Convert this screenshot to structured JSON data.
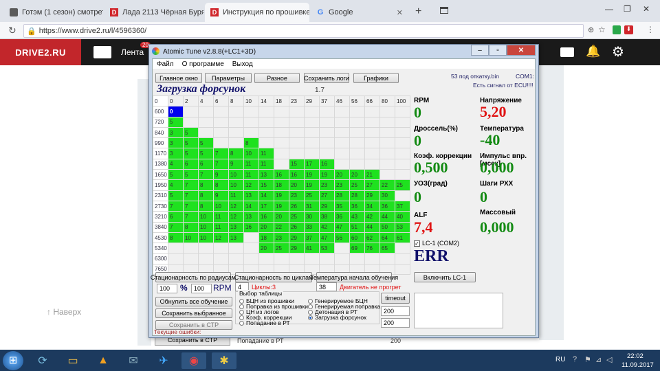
{
  "browser": {
    "tabs": [
      {
        "label": "Готэм (1 сезон) смотреть онлай",
        "fav_color": "#5a5a5a"
      },
      {
        "label": "Лада 2113 Чёрная Буря",
        "fav_color": "#d0262b",
        "fav_letter": "D"
      },
      {
        "label": "Инструкция по прошивке ВАЗ",
        "fav_color": "#d0262b",
        "fav_letter": "D"
      },
      {
        "label": "Google",
        "fav_letter": "G"
      }
    ],
    "url": "https://www.drive2.ru/l/4596360/",
    "win_min": "—",
    "win_max": "❐",
    "win_close": "✕"
  },
  "site": {
    "logo": "DRIVE2.RU",
    "nav_lenta": "Лента",
    "badge": "20",
    "back_link": "↑ Наверх",
    "bg_rows": [
      "Сохранить в СТР",
      "Попадание в РТ",
      "200"
    ]
  },
  "app": {
    "title": "Atomic Tune   v2.8.8(+LC1+3D)",
    "menu": [
      "Файл",
      "О программе",
      "Выход"
    ],
    "toolbar": [
      "Главное окно",
      "Параметры",
      "Разное",
      "Сохранить логи",
      "Графики"
    ],
    "info_file": "53 под откатку.bin",
    "info_com": "COM1:",
    "info_ecu": "Есть сигнал от ECU!!!!",
    "section_title": "Загрузка форсунок",
    "section_value": "1.7",
    "col_headers": [
      "0",
      "0",
      "2",
      "4",
      "6",
      "8",
      "10",
      "14",
      "18",
      "23",
      "29",
      "37",
      "46",
      "56",
      "66",
      "80",
      "100"
    ],
    "rows": [
      {
        "rpm": "600",
        "cells": [
          [
            "0",
            "b"
          ]
        ]
      },
      {
        "rpm": "720",
        "cells": [
          [
            "5",
            "g"
          ]
        ]
      },
      {
        "rpm": "840",
        "cells": [
          [
            "3",
            "g"
          ],
          [
            "5",
            "g"
          ]
        ]
      },
      {
        "rpm": "990",
        "cells": [
          [
            "3",
            "g"
          ],
          [
            "5",
            "g"
          ],
          [
            "5",
            "g"
          ],
          [
            "",
            ""
          ],
          [
            "",
            ""
          ],
          [
            "8",
            "g"
          ]
        ]
      },
      {
        "rpm": "1170",
        "cells": [
          [
            "3",
            "g"
          ],
          [
            "5",
            "g"
          ],
          [
            "5",
            "g"
          ],
          [
            "7",
            "g"
          ],
          [
            "8",
            "g"
          ],
          [
            "10",
            "g"
          ],
          [
            "11",
            "g"
          ]
        ]
      },
      {
        "rpm": "1380",
        "cells": [
          [
            "4",
            "g"
          ],
          [
            "6",
            "g"
          ],
          [
            "6",
            "g"
          ],
          [
            "7",
            "g"
          ],
          [
            "9",
            "g"
          ],
          [
            "11",
            "g"
          ],
          [
            "11",
            "g"
          ],
          [
            "",
            ""
          ],
          [
            "15",
            "g"
          ],
          [
            "17",
            "g"
          ],
          [
            "16",
            "g"
          ]
        ]
      },
      {
        "rpm": "1650",
        "cells": [
          [
            "5",
            "g"
          ],
          [
            "5",
            "g"
          ],
          [
            "7",
            "g"
          ],
          [
            "9",
            "g"
          ],
          [
            "10",
            "g"
          ],
          [
            "11",
            "g"
          ],
          [
            "13",
            "g"
          ],
          [
            "16",
            "g"
          ],
          [
            "16",
            "g"
          ],
          [
            "19",
            "g"
          ],
          [
            "19",
            "g"
          ],
          [
            "20",
            "g"
          ],
          [
            "20",
            "g"
          ],
          [
            "21",
            "g"
          ]
        ]
      },
      {
        "rpm": "1950",
        "cells": [
          [
            "4",
            "g"
          ],
          [
            "7",
            "g"
          ],
          [
            "8",
            "g"
          ],
          [
            "8",
            "g"
          ],
          [
            "10",
            "g"
          ],
          [
            "12",
            "g"
          ],
          [
            "15",
            "g"
          ],
          [
            "18",
            "g"
          ],
          [
            "20",
            "g"
          ],
          [
            "19",
            "g"
          ],
          [
            "23",
            "g"
          ],
          [
            "23",
            "g"
          ],
          [
            "25",
            "g"
          ],
          [
            "27",
            "g"
          ],
          [
            "22",
            "g"
          ],
          [
            "25",
            "g"
          ]
        ]
      },
      {
        "rpm": "2310",
        "cells": [
          [
            "5",
            "g"
          ],
          [
            "7",
            "g"
          ],
          [
            "8",
            "g"
          ],
          [
            "9",
            "g"
          ],
          [
            "11",
            "g"
          ],
          [
            "13",
            "g"
          ],
          [
            "14",
            "g"
          ],
          [
            "19",
            "g"
          ],
          [
            "23",
            "g"
          ],
          [
            "25",
            "g"
          ],
          [
            "27",
            "g"
          ],
          [
            "28",
            "g"
          ],
          [
            "28",
            "g"
          ],
          [
            "29",
            "g"
          ],
          [
            "30",
            "g"
          ]
        ]
      },
      {
        "rpm": "2730",
        "cells": [
          [
            "7",
            "g"
          ],
          [
            "7",
            "g"
          ],
          [
            "8",
            "g"
          ],
          [
            "10",
            "g"
          ],
          [
            "12",
            "g"
          ],
          [
            "14",
            "g"
          ],
          [
            "17",
            "g"
          ],
          [
            "19",
            "g"
          ],
          [
            "26",
            "g"
          ],
          [
            "31",
            "g"
          ],
          [
            "29",
            "g"
          ],
          [
            "35",
            "g"
          ],
          [
            "36",
            "g"
          ],
          [
            "34",
            "g"
          ],
          [
            "36",
            "g"
          ],
          [
            "37",
            "g"
          ]
        ]
      },
      {
        "rpm": "3210",
        "cells": [
          [
            "6",
            "g"
          ],
          [
            "7",
            "g"
          ],
          [
            "10",
            "g"
          ],
          [
            "11",
            "g"
          ],
          [
            "12",
            "g"
          ],
          [
            "13",
            "g"
          ],
          [
            "16",
            "g"
          ],
          [
            "20",
            "g"
          ],
          [
            "25",
            "g"
          ],
          [
            "30",
            "g"
          ],
          [
            "38",
            "g"
          ],
          [
            "36",
            "g"
          ],
          [
            "43",
            "g"
          ],
          [
            "42",
            "g"
          ],
          [
            "44",
            "g"
          ],
          [
            "40",
            "g"
          ]
        ]
      },
      {
        "rpm": "3840",
        "cells": [
          [
            "7",
            "g"
          ],
          [
            "8",
            "g"
          ],
          [
            "10",
            "g"
          ],
          [
            "11",
            "g"
          ],
          [
            "13",
            "g"
          ],
          [
            "16",
            "g"
          ],
          [
            "20",
            "g"
          ],
          [
            "22",
            "g"
          ],
          [
            "26",
            "g"
          ],
          [
            "33",
            "g"
          ],
          [
            "42",
            "g"
          ],
          [
            "47",
            "g"
          ],
          [
            "51",
            "g"
          ],
          [
            "44",
            "g"
          ],
          [
            "50",
            "g"
          ],
          [
            "53",
            "g"
          ]
        ]
      },
      {
        "rpm": "4530",
        "cells": [
          [
            "8",
            "g"
          ],
          [
            "10",
            "g"
          ],
          [
            "10",
            "g"
          ],
          [
            "12",
            "g"
          ],
          [
            "13",
            "g"
          ],
          [
            "",
            ""
          ],
          [
            "18",
            "g"
          ],
          [
            "23",
            "g"
          ],
          [
            "29",
            "g"
          ],
          [
            "37",
            "g"
          ],
          [
            "47",
            "g"
          ],
          [
            "56",
            "g"
          ],
          [
            "60",
            "g"
          ],
          [
            "62",
            "g"
          ],
          [
            "64",
            "g"
          ],
          [
            "61",
            "g"
          ]
        ]
      },
      {
        "rpm": "5340",
        "cells": [
          [
            "",
            ""
          ],
          [
            "",
            ""
          ],
          [
            "",
            ""
          ],
          [
            "",
            ""
          ],
          [
            "",
            ""
          ],
          [
            "",
            ""
          ],
          [
            "20",
            "g"
          ],
          [
            "25",
            "g"
          ],
          [
            "29",
            "g"
          ],
          [
            "41",
            "g"
          ],
          [
            "53",
            "g"
          ],
          [
            "",
            ""
          ],
          [
            "69",
            "g"
          ],
          [
            "76",
            "g"
          ],
          [
            "65",
            "g"
          ]
        ]
      },
      {
        "rpm": "6300",
        "cells": []
      },
      {
        "rpm": "7650",
        "cells": []
      }
    ],
    "params": {
      "rpm_label": "RPM",
      "rpm_value": "0",
      "volt_label": "Напряжение",
      "volt_value": "5,20",
      "throttle_label": "Дроссель(%)",
      "throttle_value": "0",
      "temp_label": "Температура",
      "temp_value": "-40",
      "corr_label": "Коэф. коррекции",
      "corr_value": "0,500",
      "inj_label": "Импульс впр.[мсек]",
      "inj_value": "0,000",
      "uoz_label": "УОЗ(град)",
      "uoz_value": "0",
      "rhh_label": "Шаги РХХ",
      "rhh_value": "0",
      "alf_label": "ALF",
      "alf_value": "7,4",
      "mass_label": "Массовый",
      "mass_value": "0,000",
      "lc1_label": "LC-1 (COM2)",
      "err": "ERR"
    },
    "bottom": {
      "btn_stat_radius": "Стационарность по радиусам",
      "btn_stat_cycles": "Стационарность по циклам",
      "btn_temp_start": "Температура начала обучения",
      "btn_lc1": "Включить LC-1",
      "pct1": "100",
      "pct_sign": "%",
      "pct2": "100",
      "rpm_unit": "RPM",
      "cycles_value": "4",
      "cycles_label": "Циклы:3",
      "temp_value": "38",
      "temp_msg": "Двигатель не прогрет",
      "btn_reset": "Обнулить все обучение",
      "btn_save_sel": "Сохранить выбранное",
      "btn_save_str": "Сохранить в СТР",
      "errors_label": "Текущие ошибки:",
      "select_label": "Выбор таблицы",
      "radios_left": [
        "БЦН из прошивки",
        "Поправка из прошивки",
        "ЦН из логов",
        "Коэф. коррекции",
        "Попадание в РТ"
      ],
      "radios_right": [
        "Генерируемое БЦН",
        "Генерируемая поправка",
        "Детонация в РТ",
        "Загрузка форсунок"
      ],
      "btn_timeout": "timeout",
      "val200a": "200",
      "val200b": "200"
    }
  },
  "taskbar": {
    "lang": "RU",
    "time": "22:02",
    "date": "11.09.2017"
  }
}
